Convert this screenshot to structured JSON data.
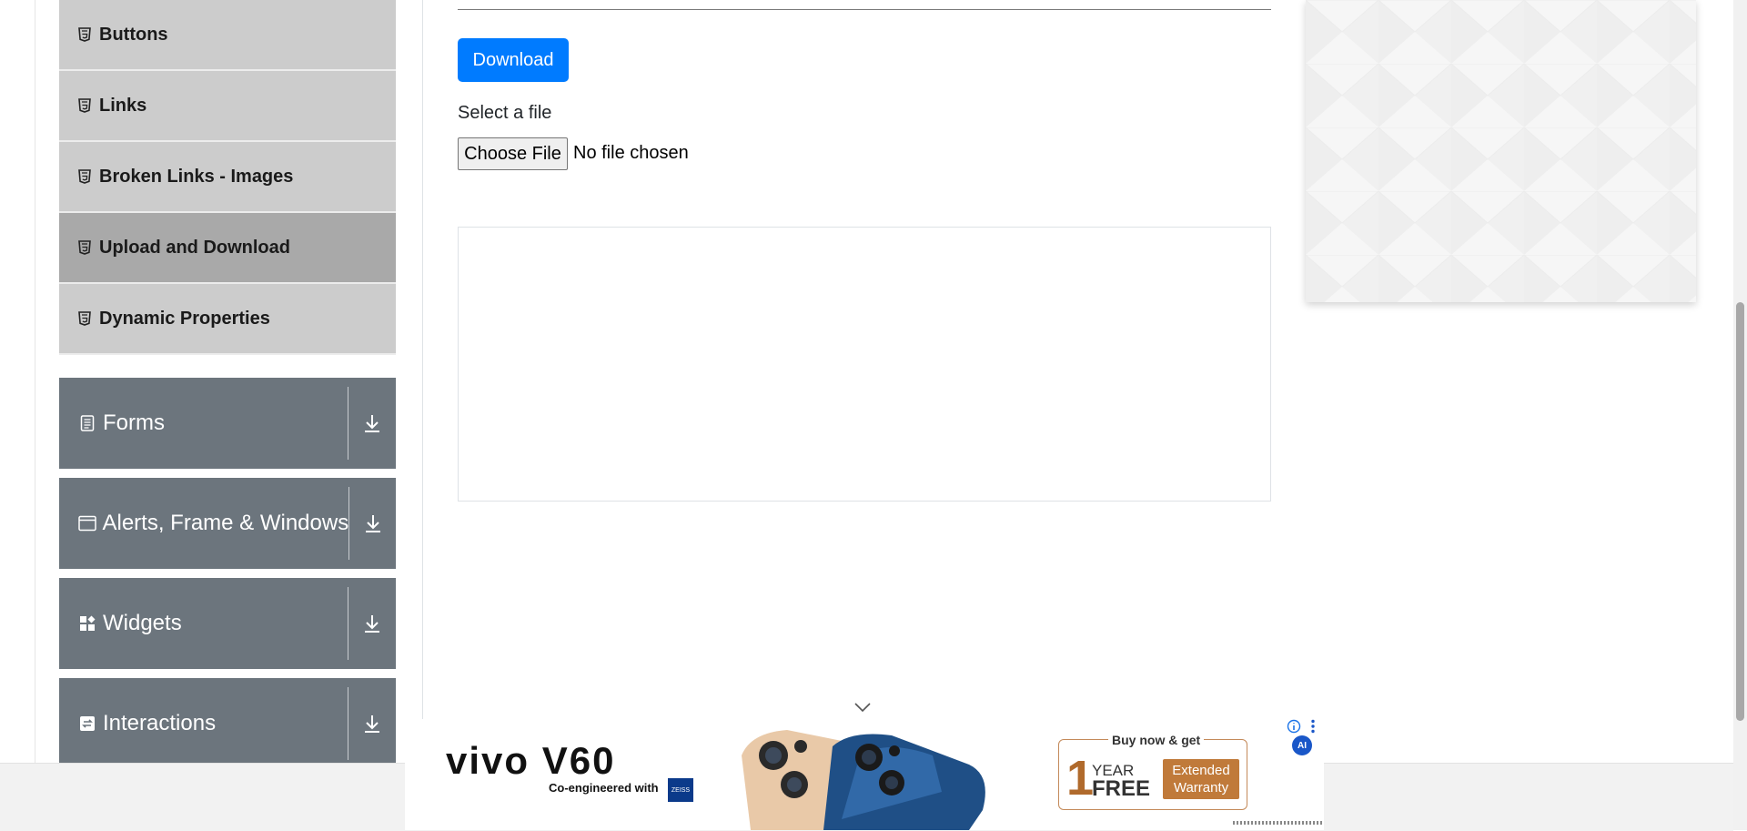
{
  "sidebar": {
    "items": [
      {
        "label": "Buttons",
        "active": false
      },
      {
        "label": "Links",
        "active": false
      },
      {
        "label": "Broken Links - Images",
        "active": false
      },
      {
        "label": "Upload and Download",
        "active": true
      },
      {
        "label": "Dynamic Properties",
        "active": false
      }
    ],
    "groups": [
      {
        "label": "Forms",
        "icon": "form-icon"
      },
      {
        "label": "Alerts, Frame & Windows",
        "icon": "window-icon"
      },
      {
        "label": "Widgets",
        "icon": "widgets-icon"
      },
      {
        "label": "Interactions",
        "icon": "interactions-icon"
      }
    ]
  },
  "main": {
    "download_label": "Download",
    "upload_label": "Select a file",
    "choose_file_label": "Choose File",
    "no_file_text": "No file chosen"
  },
  "ad": {
    "brand": "vivo V60",
    "co_text": "Co-engineered with",
    "zeiss": "ZEISS",
    "offer_title": "Buy now & get",
    "offer_number": "1",
    "offer_year": "YEAR",
    "offer_free": "FREE",
    "offer_warranty_line1": "Extended",
    "offer_warranty_line2": "Warranty",
    "ai_badge": "AI"
  },
  "colors": {
    "primary": "#007bff",
    "group_bg": "#6c757d",
    "item_bg": "#cccccc",
    "item_active_bg": "#a9a9a9"
  }
}
